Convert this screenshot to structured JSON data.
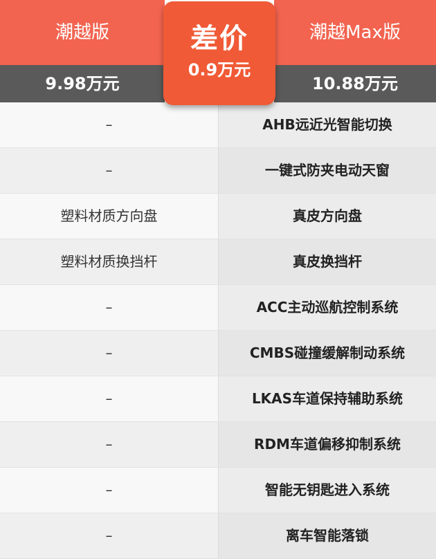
{
  "left_trim": {
    "name": "潮越版",
    "price": "9.98万元"
  },
  "price_difference": {
    "title": "差价",
    "value": "0.9万元"
  },
  "right_trim": {
    "name": "潮越Max版",
    "price": "10.88万元"
  },
  "colors": {
    "header_orange": "#f26450",
    "price_bar_gray": "#5a5a5a",
    "badge_orange": "#f05a36"
  },
  "rows": [
    {
      "left": "–",
      "right": "AHB远近光智能切换"
    },
    {
      "left": "–",
      "right": "一键式防夹电动天窗"
    },
    {
      "left": "塑料材质方向盘",
      "right": "真皮方向盘"
    },
    {
      "left": "塑料材质换挡杆",
      "right": "真皮换挡杆"
    },
    {
      "left": "–",
      "right": "ACC主动巡航控制系统"
    },
    {
      "left": "–",
      "right": "CMBS碰撞缓解制动系统"
    },
    {
      "left": "–",
      "right": "LKAS车道保持辅助系统"
    },
    {
      "left": "–",
      "right": "RDM车道偏移抑制系统"
    },
    {
      "left": "–",
      "right": "智能无钥匙进入系统"
    },
    {
      "left": "–",
      "right": "离车智能落锁"
    }
  ]
}
